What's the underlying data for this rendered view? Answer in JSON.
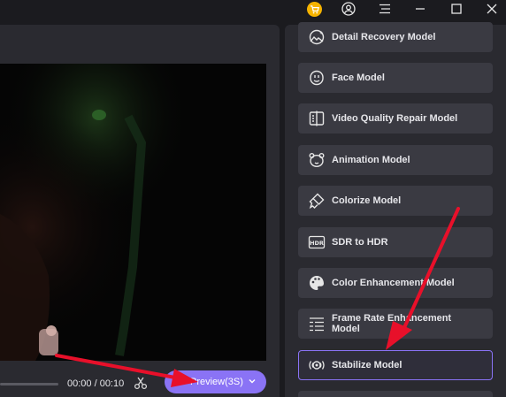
{
  "titlebar": {
    "icons": [
      "cart-icon",
      "user-icon",
      "menu-icon",
      "minimize-icon",
      "maximize-icon",
      "close-icon"
    ]
  },
  "player": {
    "time": "00:00 / 00:10",
    "preview_label": "Preview(3S)"
  },
  "models": [
    {
      "label": "Detail Recovery Model",
      "icon": "detail-recovery-icon"
    },
    {
      "label": "Face Model",
      "icon": "face-icon"
    },
    {
      "label": "Video Quality Repair Model",
      "icon": "video-repair-icon"
    },
    {
      "label": "Animation Model",
      "icon": "animation-bear-icon"
    },
    {
      "label": "Colorize Model",
      "icon": "colorize-brush-icon"
    },
    {
      "label": "SDR to HDR",
      "icon": "hdr-icon"
    },
    {
      "label": "Color Enhancement Model",
      "icon": "palette-icon"
    },
    {
      "label": "Frame Rate Enhancement Model",
      "icon": "frame-rate-icon"
    },
    {
      "label": "Stabilize Model",
      "icon": "stabilize-icon",
      "selected": true
    }
  ],
  "colors": {
    "accent": "#8a73f5",
    "annotation_arrow": "#e8102a",
    "panel": "#2a2a30",
    "button": "#3a3a42"
  }
}
